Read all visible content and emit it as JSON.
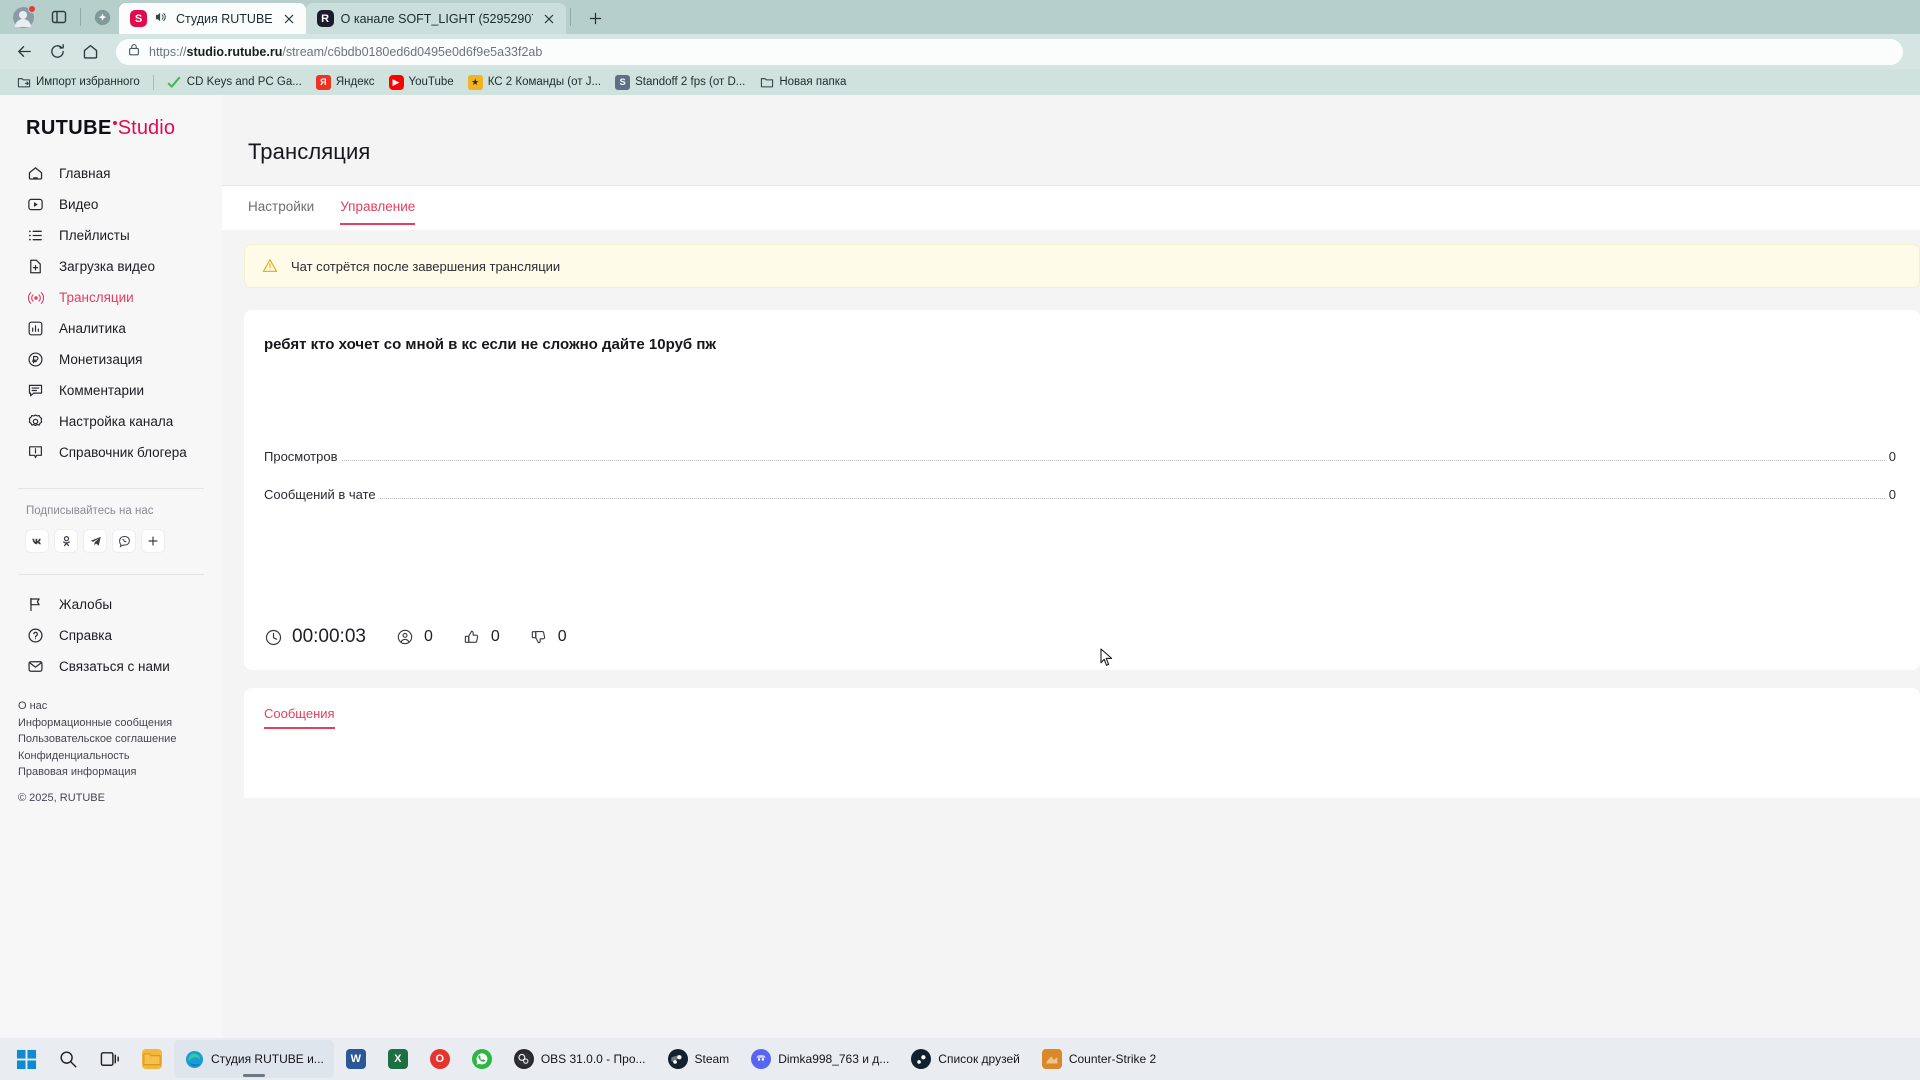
{
  "browser": {
    "tabs": [
      {
        "title": "Студия RUTUBE",
        "favicon": "rutube-studio-icon",
        "active": true,
        "muted_audio": true
      },
      {
        "title": "О канале SOFT_LIGHT (52952907",
        "favicon": "rutube-icon",
        "active": false,
        "muted_audio": false
      }
    ],
    "newtab_label": "+",
    "address": {
      "prefix": "https://",
      "host": "studio.rutube.ru",
      "path": "/stream/c6bdb0180ed6d0495e0d6f9e5a33f2ab",
      "full": "https://studio.rutube.ru/stream/c6bdb0180ed6d0495e0d6f9e5a33f2ab"
    },
    "nav": {
      "back": "←",
      "reload": "⟳",
      "home": "⌂"
    },
    "bookmarks": [
      {
        "label": "Импорт избранного",
        "icon": "import-folder-icon"
      },
      {
        "label": "CD Keys and PC Ga...",
        "icon": "green-check-icon"
      },
      {
        "label": "Яндекс",
        "icon": "yandex-icon"
      },
      {
        "label": "YouTube",
        "icon": "youtube-icon"
      },
      {
        "label": "КС 2 Команды (от J...",
        "icon": "cs2-icon"
      },
      {
        "label": "Standoff 2 fps (от D...",
        "icon": "standoff-icon"
      },
      {
        "label": "Новая папка",
        "icon": "folder-icon"
      }
    ]
  },
  "sidebar": {
    "logo": {
      "brand": "RUTUBE",
      "suffix": "Studio"
    },
    "items": [
      {
        "label": "Главная",
        "icon": "home-icon",
        "active": false
      },
      {
        "label": "Видео",
        "icon": "video-play-icon",
        "active": false
      },
      {
        "label": "Плейлисты",
        "icon": "playlist-icon",
        "active": false
      },
      {
        "label": "Загрузка видео",
        "icon": "upload-file-icon",
        "active": false
      },
      {
        "label": "Трансляции",
        "icon": "broadcast-icon",
        "active": true
      },
      {
        "label": "Аналитика",
        "icon": "chart-bars-icon",
        "active": false
      },
      {
        "label": "Монетизация",
        "icon": "ruble-circle-icon",
        "active": false
      },
      {
        "label": "Комментарии",
        "icon": "comment-icon",
        "active": false
      },
      {
        "label": "Настройка канала",
        "icon": "gear-icon",
        "active": false
      },
      {
        "label": "Справочник блогера",
        "icon": "info-tooltip-icon",
        "active": false
      }
    ],
    "follow_title": "Подписывайтесь на нас",
    "socials": [
      {
        "name": "vk-icon",
        "glyph": "VK"
      },
      {
        "name": "odnoklassniki-icon",
        "glyph": "OK"
      },
      {
        "name": "telegram-icon",
        "glyph": "TG"
      },
      {
        "name": "viber-icon",
        "glyph": "VB"
      },
      {
        "name": "more-icon",
        "glyph": "+"
      }
    ],
    "bottom_items": [
      {
        "label": "Жалобы",
        "icon": "flag-icon"
      },
      {
        "label": "Справка",
        "icon": "question-circle-icon"
      },
      {
        "label": "Связаться с нами",
        "icon": "mail-icon"
      }
    ],
    "footer_links": [
      "О нас",
      "Информационные сообщения",
      "Пользовательское соглашение",
      "Конфиденциальность",
      "Правовая информация"
    ],
    "copyright": "© 2025, RUTUBE"
  },
  "main": {
    "page_title": "Трансляция",
    "tabs": [
      {
        "label": "Настройки",
        "active": false
      },
      {
        "label": "Управление",
        "active": true
      }
    ],
    "notice": {
      "text": "Чат сотрётся после завершения трансляции",
      "icon": "warning-triangle-icon"
    },
    "stream": {
      "name": "ребят кто хочет со мной в кс если не сложно дайте 10руб пж",
      "stats": [
        {
          "label": "Просмотров",
          "value": "0"
        },
        {
          "label": "Сообщений в чате",
          "value": "0"
        }
      ],
      "metrics": [
        {
          "name": "duration",
          "icon": "clock-icon",
          "value": "00:00:03"
        },
        {
          "name": "viewers",
          "icon": "viewers-icon",
          "value": "0"
        },
        {
          "name": "likes",
          "icon": "thumbs-up-icon",
          "value": "0"
        },
        {
          "name": "dislikes",
          "icon": "thumbs-down-icon",
          "value": "0"
        }
      ]
    },
    "messages_tab": "Сообщения"
  },
  "taskbar": {
    "start": "windows-start-icon",
    "search": "search-icon",
    "taskview": "task-view-icon",
    "apps": [
      {
        "label": "",
        "icon": "file-explorer-icon",
        "active": false,
        "color": "#f4b63f"
      },
      {
        "label": "Студия RUTUBE и...",
        "icon": "edge-icon",
        "active": true,
        "color": "#1f9ad6"
      },
      {
        "label": "",
        "icon": "word-icon",
        "active": false,
        "color": "#2b5797"
      },
      {
        "label": "",
        "icon": "excel-icon",
        "active": false,
        "color": "#1d7044"
      },
      {
        "label": "",
        "icon": "opera-icon",
        "active": false,
        "color": "#e5342d"
      },
      {
        "label": "",
        "icon": "whatsapp-icon",
        "active": false,
        "color": "#2db742"
      },
      {
        "label": "OBS 31.0.0 - Про...",
        "icon": "obs-icon",
        "active": false,
        "color": "#2a2a2e"
      },
      {
        "label": "Steam",
        "icon": "steam-icon",
        "active": false,
        "color": "#1b2838"
      },
      {
        "label": "Dimka998_763 и д...",
        "icon": "discord-icon",
        "active": false,
        "color": "#5865f2"
      },
      {
        "label": "Список друзей",
        "icon": "steam-friends-icon",
        "active": false,
        "color": "#1b2838"
      },
      {
        "label": "Counter-Strike 2",
        "icon": "cs2-icon",
        "active": false,
        "color": "#d9882a"
      }
    ]
  },
  "colors": {
    "accent": "#e3405f",
    "brand": "#e10b4e",
    "chrome_tabstrip": "#b6cfcb",
    "notice_bg": "#fefbe8"
  }
}
